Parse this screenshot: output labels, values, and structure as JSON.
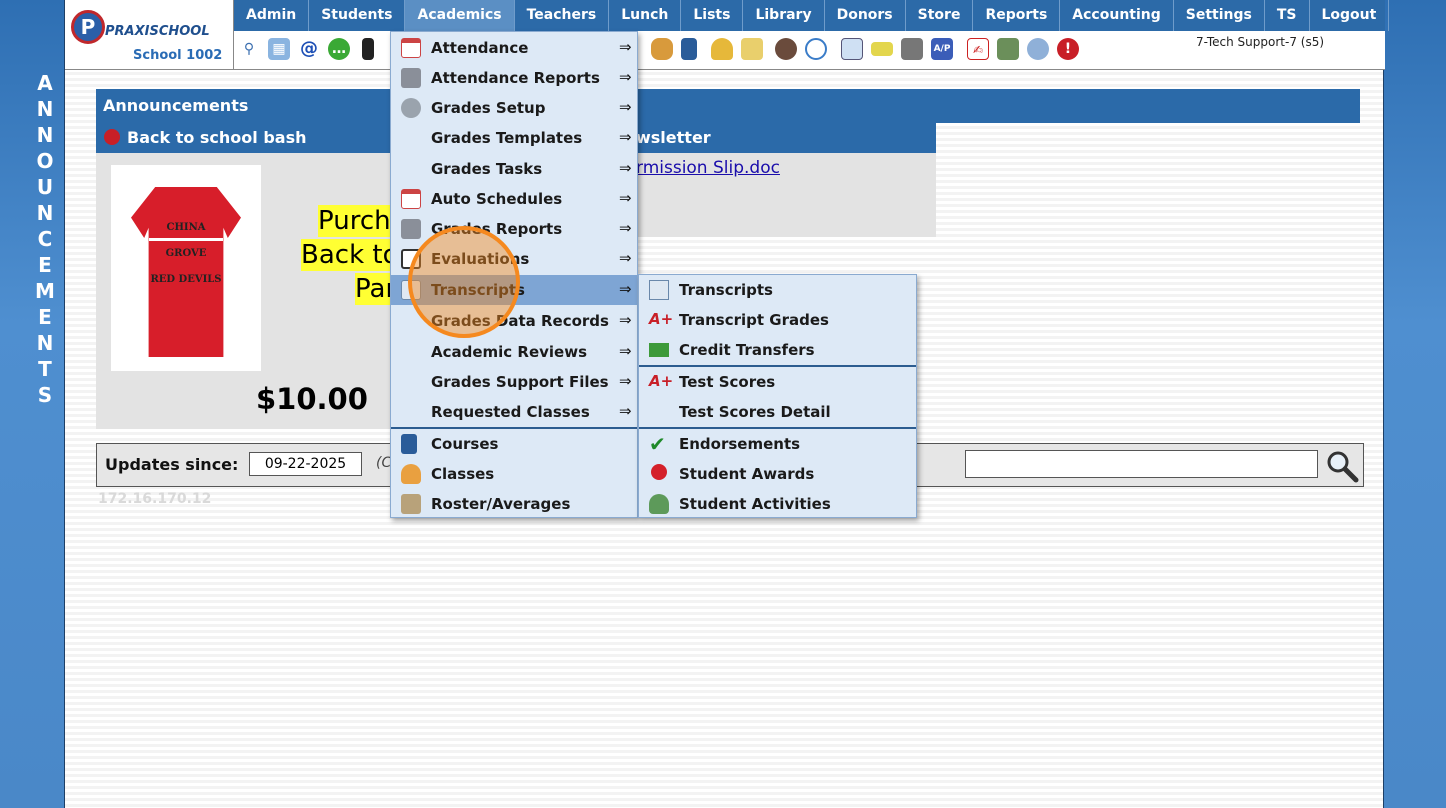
{
  "side_label": [
    "A",
    "N",
    "N",
    "O",
    "U",
    "N",
    "C",
    "E",
    "M",
    "E",
    "N",
    "T",
    "S"
  ],
  "logo": {
    "brand": "PRAXISCHOOL",
    "mark": "P",
    "school": "School 1002"
  },
  "menu": [
    "Admin",
    "Students",
    "Academics",
    "Teachers",
    "Lunch",
    "Lists",
    "Library",
    "Donors",
    "Store",
    "Reports",
    "Accounting",
    "Settings",
    "TS",
    "Logout"
  ],
  "toolbar_icons": [
    "search-icon",
    "calendar-grid-icon",
    "email-icon",
    "chat-icon",
    "phone-icon",
    "burger-icon",
    "book-icon",
    "bell-icon",
    "arrow-note-icon",
    "teacher-icon",
    "clock-icon",
    "list-icon",
    "ticket-icon",
    "printer-icon",
    "ap-icon",
    "pdf-icon",
    "money-icon",
    "help-icon",
    "alert-icon"
  ],
  "user": "7-Tech Support-7 (s5)",
  "announcements": {
    "header": "Announcements",
    "title": "Back to school bash",
    "title_right": "wsletter",
    "link": "rmission Slip.doc",
    "promo_lines": [
      "Purcha",
      "Back to",
      "Par"
    ],
    "price": "$10.00",
    "shirt_lines": [
      "CHINA GROVE",
      "RED DEVILS"
    ]
  },
  "updates": {
    "label": "Updates since:",
    "date": "09-22-2025",
    "note_fragment": "(C",
    "ip": "172.16.170.12"
  },
  "academics_menu": [
    {
      "label": "Attendance",
      "icon": "calendar-icon",
      "arrow": true
    },
    {
      "label": "Attendance Reports",
      "icon": "printer-icon",
      "arrow": true
    },
    {
      "label": "Grades Setup",
      "icon": "gear-icon",
      "arrow": true
    },
    {
      "label": "Grades Templates",
      "icon": "",
      "arrow": true
    },
    {
      "label": "Grades Tasks",
      "icon": "",
      "arrow": true
    },
    {
      "label": "Auto Schedules",
      "icon": "calendar-clock-icon",
      "arrow": true
    },
    {
      "label": "Grades Reports",
      "icon": "printer-icon",
      "arrow": true
    },
    {
      "label": "Evaluations",
      "icon": "checkbox-icon",
      "arrow": true
    },
    {
      "label": "Transcripts",
      "icon": "scroll-icon",
      "arrow": true
    },
    {
      "label": "Grades Data Records",
      "icon": "",
      "arrow": true
    },
    {
      "label": "Academic Reviews",
      "icon": "",
      "arrow": true
    },
    {
      "label": "Grades Support Files",
      "icon": "",
      "arrow": true
    },
    {
      "label": "Requested Classes",
      "icon": "",
      "arrow": true
    },
    {
      "label": "Courses",
      "icon": "book-icon",
      "arrow": false
    },
    {
      "label": "Classes",
      "icon": "person-icon",
      "arrow": false
    },
    {
      "label": "Roster/Averages",
      "icon": "roster-icon",
      "arrow": false
    }
  ],
  "transcripts_submenu": [
    {
      "label": "Transcripts",
      "icon": "scroll-icon"
    },
    {
      "label": "Transcript Grades",
      "icon": "a-plus-icon"
    },
    {
      "label": "Credit Transfers",
      "icon": "transfer-icon"
    },
    {
      "label": "Test Scores",
      "icon": "a-plus-icon"
    },
    {
      "label": "Test Scores Detail",
      "icon": ""
    },
    {
      "label": "Endorsements",
      "icon": "checkmark-icon"
    },
    {
      "label": "Student Awards",
      "icon": "award-ribbon-icon"
    },
    {
      "label": "Student Activities",
      "icon": "people-icon"
    }
  ],
  "arrow_glyph": "⇒"
}
